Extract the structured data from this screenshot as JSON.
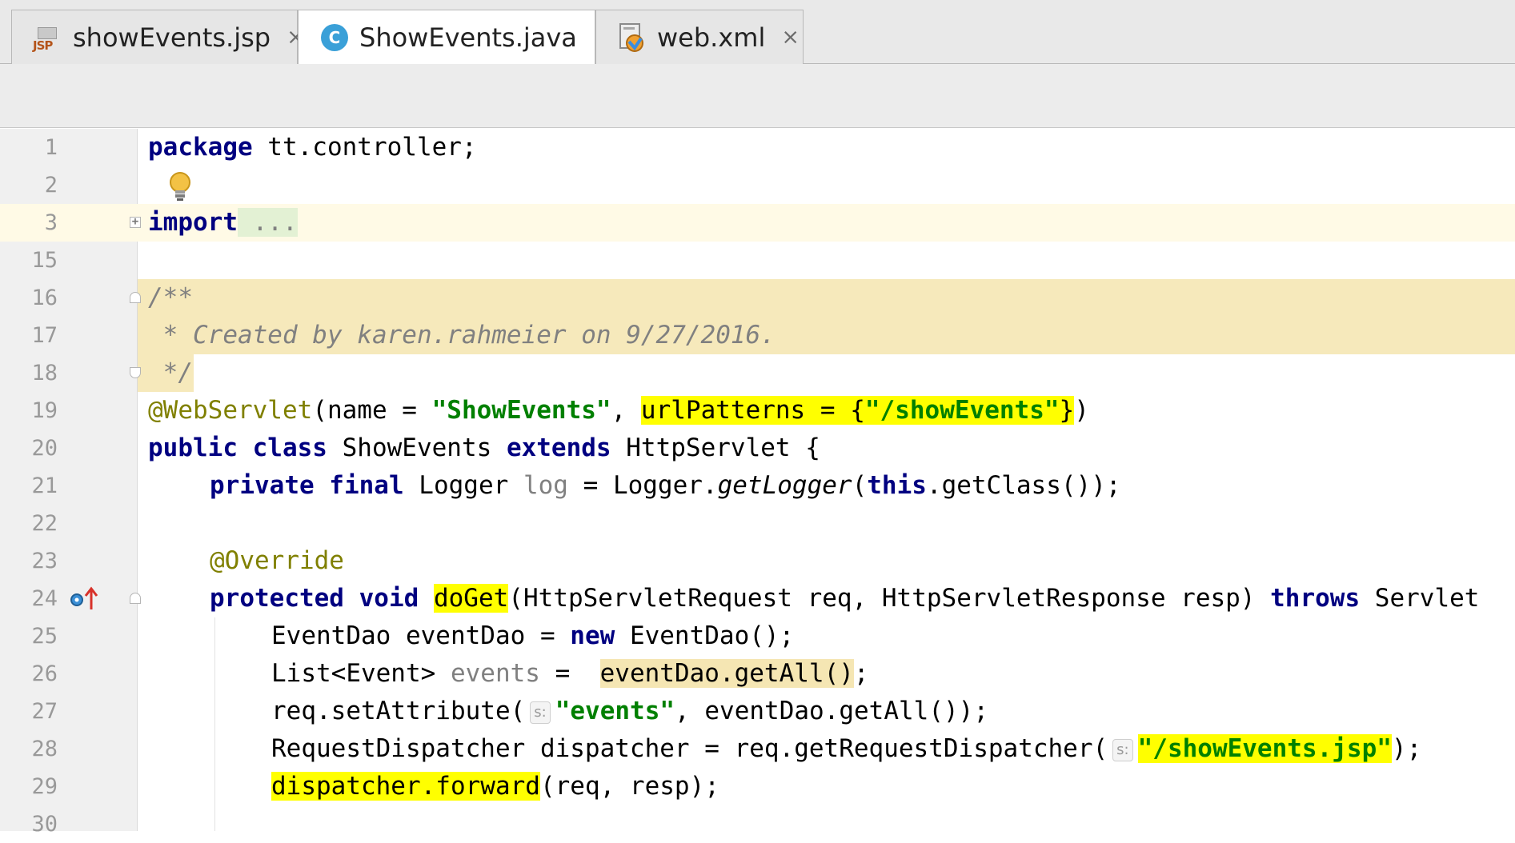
{
  "tabs": [
    {
      "label": "showEvents.jsp",
      "close": "×",
      "icon": "jsp-file-icon",
      "icon_text": "JSP",
      "active": false
    },
    {
      "label": "ShowEvents.java",
      "close": "×",
      "icon": "java-class-icon",
      "icon_text": "C",
      "active": true
    },
    {
      "label": "web.xml",
      "close": "×",
      "icon": "xml-file-icon",
      "active": false
    }
  ],
  "line_numbers": [
    "1",
    "2",
    "3",
    "15",
    "16",
    "17",
    "18",
    "19",
    "20",
    "21",
    "22",
    "23",
    "24",
    "25",
    "26",
    "27",
    "28",
    "29",
    "30"
  ],
  "code": {
    "l1": {
      "kw": "package",
      "rest": " tt.controller;"
    },
    "l3": {
      "kw": "import",
      "rest": " ..."
    },
    "l16": "/**",
    "l17": " * Created by karen.rahmeier on 9/27/2016.",
    "l18": " */",
    "l19": {
      "ann": "@WebServlet",
      "a": "(name = ",
      "s1": "\"ShowEvents\"",
      "b": ", ",
      "hl_a": "urlPatterns = {",
      "s2": "\"/showEvents\"",
      "hl_b": "}",
      "c": ")"
    },
    "l20": {
      "kw1": "public class",
      "a": " ShowEvents ",
      "kw2": "extends",
      "b": " HttpServlet {"
    },
    "l21": {
      "kw": "private final",
      "a": " Logger ",
      "g": "log",
      "b": " = Logger.",
      "i": "getLogger",
      "c": "(",
      "kw2": "this",
      "d": ".getClass());"
    },
    "l23": {
      "ann": "@Override"
    },
    "l24": {
      "kw": "protected void",
      "hl": "doGet",
      "a": "(HttpServletRequest req, HttpServletResponse resp) ",
      "kw2": "throws",
      "b": " Servlet"
    },
    "l25": {
      "a": "EventDao eventDao = ",
      "kw": "new",
      "b": " EventDao();"
    },
    "l26": {
      "a": "List<Event> ",
      "g": "events",
      "b": " = ",
      "hl": "eventDao.getAll()",
      "c": ";"
    },
    "l27": {
      "a": "req.setAttribute(",
      "hint": "s:",
      "s": "\"events\"",
      "b": ", eventDao.getAll());"
    },
    "l28": {
      "a": "RequestDispatcher dispatcher = req.getRequestDispatcher(",
      "hint": "s:",
      "s": "\"/showEvents.jsp\"",
      "b": ");"
    },
    "l29": {
      "hl": "dispatcher.forward",
      "a": "(req, resp);"
    }
  },
  "colors": {
    "keyword": "#000080",
    "string": "#008000",
    "annotation": "#808000",
    "comment": "#808080",
    "highlight": "#ffff00",
    "doc_comment_bg": "#f6e9bb"
  }
}
